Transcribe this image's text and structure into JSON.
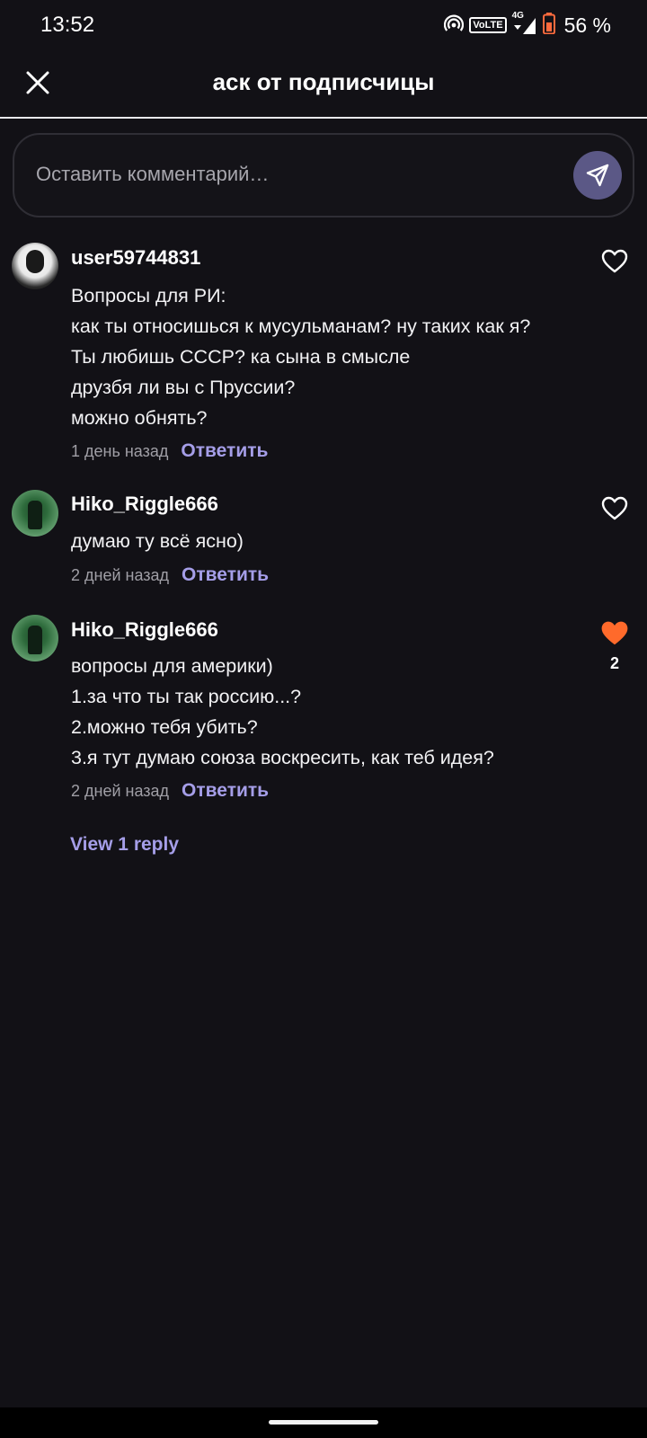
{
  "status_bar": {
    "time": "13:52",
    "network_badge": "VoLTE",
    "network_type": "4G",
    "battery_percent": "56 %",
    "icons": [
      "hotspot-icon",
      "signal-icon",
      "battery-icon"
    ]
  },
  "header": {
    "title": "аск от подписчицы",
    "close_icon": "close-icon"
  },
  "composer": {
    "placeholder": "Оставить комментарий…",
    "send_icon": "send-icon",
    "send_button_color": "#5b5886"
  },
  "comments": [
    {
      "username": "user59744831",
      "lines": [
        "Вопросы для РИ:",
        "как ты относишься к мусульманам? ну таких как я?",
        "Ты любишь СССР? ка сына в смысле",
        "друзбя ли вы с Пруссии?",
        "можно обнять?"
      ],
      "time": "1 день назад",
      "reply_label": "Ответить",
      "liked": false,
      "like_count": ""
    },
    {
      "username": "Hiko_Riggle666",
      "lines": [
        "думаю ту всё ясно)"
      ],
      "time": "2 дней назад",
      "reply_label": "Ответить",
      "liked": false,
      "like_count": ""
    },
    {
      "username": "Hiko_Riggle666",
      "lines": [
        "вопросы для америки)",
        "1.за что ты так россию...?",
        "2.можно тебя убить?",
        "3.я тут думаю союза воскресить, как теб идея?"
      ],
      "time": "2 дней назад",
      "reply_label": "Ответить",
      "liked": true,
      "like_count": "2"
    }
  ],
  "view_replies_label": "View 1 reply",
  "colors": {
    "background": "#121116",
    "accent": "#a59ee8",
    "liked_heart": "#ff6a2b"
  }
}
